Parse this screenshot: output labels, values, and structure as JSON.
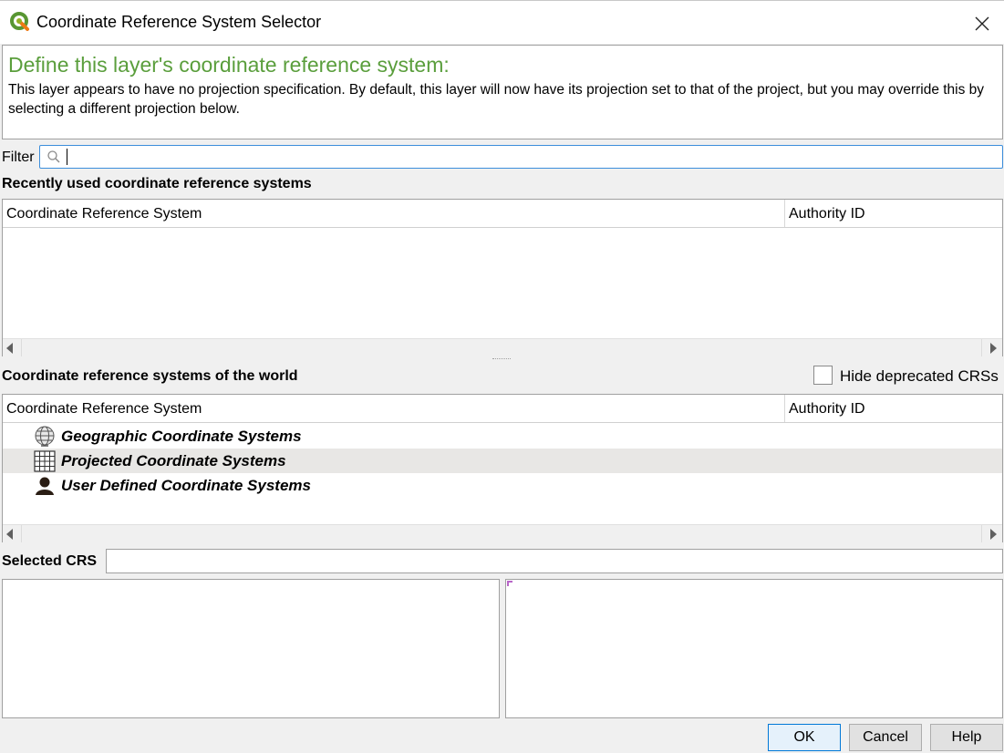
{
  "window": {
    "title": "Coordinate Reference System Selector",
    "close_icon": "close-icon"
  },
  "message": {
    "heading": "Define this layer's coordinate reference system:",
    "body": "This layer appears to have no projection specification. By default, this layer will now have its projection set to that of the project, but you may override this by selecting a different projection below."
  },
  "filter": {
    "label": "Filter",
    "value": "",
    "placeholder": ""
  },
  "recent": {
    "title": "Recently used coordinate reference systems",
    "columns": [
      "Coordinate Reference System",
      "Authority ID"
    ],
    "rows": []
  },
  "world": {
    "title": "Coordinate reference systems of the world",
    "hide_deprecated_label": "Hide deprecated CRSs",
    "hide_deprecated_checked": false,
    "columns": [
      "Coordinate Reference System",
      "Authority ID"
    ],
    "items": [
      {
        "label": "Geographic Coordinate Systems",
        "icon": "globe-icon",
        "selected": false
      },
      {
        "label": "Projected Coordinate Systems",
        "icon": "grid-icon",
        "selected": true
      },
      {
        "label": "User Defined Coordinate Systems",
        "icon": "user-icon",
        "selected": false
      }
    ]
  },
  "selected_crs": {
    "label": "Selected CRS",
    "value": ""
  },
  "buttons": {
    "ok": "OK",
    "cancel": "Cancel",
    "help": "Help"
  },
  "colors": {
    "heading_green": "#5a9e3c",
    "focus_blue": "#3c8edb",
    "selected_row": "#e8e7e5"
  }
}
